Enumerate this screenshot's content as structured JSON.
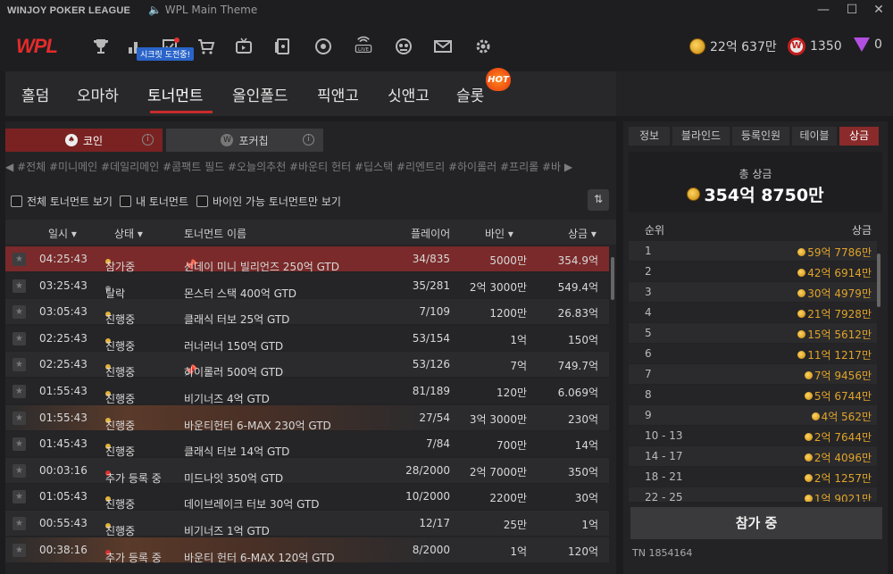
{
  "window": {
    "title": "WINJOY POKER LEAGUE",
    "music": "WPL Main Theme",
    "min": "—",
    "max": "☐",
    "close": "✕"
  },
  "topbar": {
    "logo": "WPL",
    "badge": "시크릿 도전중!",
    "coins": "22억 637만",
    "wpoints": "1350",
    "gems": "0",
    "icons": [
      "trophy-icon",
      "ranking-icon",
      "mission-icon",
      "cart-icon",
      "tv-icon",
      "cards-icon",
      "chip-icon",
      "live-icon",
      "club-icon",
      "mail-icon",
      "settings-icon"
    ]
  },
  "nav": {
    "tabs": [
      "홀덤",
      "오마하",
      "토너먼트",
      "올인폴드",
      "픽앤고",
      "싯앤고",
      "슬롯"
    ],
    "active": 2,
    "hot": "HOT"
  },
  "currency_tabs": [
    {
      "label": "코인",
      "info": "i"
    },
    {
      "label": "포커칩",
      "info": "i"
    }
  ],
  "categories": "◀ #전체 #미니메인 #데일리메인 #콤팩트 필드 #오늘의추천 #바운티 헌터 #딥스택 #리엔트리 #하이롤러 #프리롤 #바 ▶",
  "filters": [
    "전체 토너먼트 보기",
    "내 토너먼트",
    "바이인 가능 토너먼트만 보기"
  ],
  "table": {
    "headers": [
      "일시 ▾",
      "상태 ▾",
      "토너먼트 이름",
      "플레이어",
      "바인 ▾",
      "상금 ▾"
    ],
    "rows": [
      {
        "time": "04:25:43",
        "status": "참가중",
        "dot": "#e2b33a",
        "name": "선데이 미니 빌리언즈 250억 GTD",
        "pin": "📌",
        "players": "34/835",
        "buyin": "5000만",
        "prize": "354.9억"
      },
      {
        "time": "03:25:43",
        "status": "탈락",
        "dot": "#777",
        "name": "몬스터 스택 400억 GTD",
        "pin": "",
        "players": "35/281",
        "buyin": "2억 3000만",
        "prize": "549.4억"
      },
      {
        "time": "03:05:43",
        "status": "진행중",
        "dot": "#e2b33a",
        "name": "클래식 터보 25억 GTD",
        "pin": "",
        "players": "7/109",
        "buyin": "1200만",
        "prize": "26.83억"
      },
      {
        "time": "02:25:43",
        "status": "진행중",
        "dot": "#e2b33a",
        "name": "러너러너 150억 GTD",
        "pin": "",
        "players": "53/154",
        "buyin": "1억",
        "prize": "150억"
      },
      {
        "time": "02:25:43",
        "status": "진행중",
        "dot": "#e2b33a",
        "name": "하이롤러 500억 GTD",
        "pin": "📌",
        "players": "53/126",
        "buyin": "7억",
        "prize": "749.7억"
      },
      {
        "time": "01:55:43",
        "status": "진행중",
        "dot": "#e2b33a",
        "name": "비기너즈 4억 GTD",
        "pin": "",
        "players": "81/189",
        "buyin": "120만",
        "prize": "6.069억"
      },
      {
        "time": "01:55:43",
        "status": "진행중",
        "dot": "#e2b33a",
        "name": "바운티헌터 6-MAX 230억 GTD",
        "pin": "",
        "players": "27/54",
        "buyin": "3억 3000만",
        "prize": "230억"
      },
      {
        "time": "01:45:43",
        "status": "진행중",
        "dot": "#e2b33a",
        "name": "클래식 터보 14억 GTD",
        "pin": "",
        "players": "7/84",
        "buyin": "700만",
        "prize": "14억"
      },
      {
        "time": "00:03:16",
        "status": "추가 등록 중",
        "dot": "#d8322e",
        "name": "미드나잇 350억 GTD",
        "pin": "",
        "players": "28/2000",
        "buyin": "2억 7000만",
        "prize": "350억"
      },
      {
        "time": "01:05:43",
        "status": "진행중",
        "dot": "#e2b33a",
        "name": "데이브레이크 터보 30억 GTD",
        "pin": "",
        "players": "10/2000",
        "buyin": "2200만",
        "prize": "30억"
      },
      {
        "time": "00:55:43",
        "status": "진행중",
        "dot": "#e2b33a",
        "name": "비기너즈 1억 GTD",
        "pin": "",
        "players": "12/17",
        "buyin": "25만",
        "prize": "1억"
      },
      {
        "time": "00:38:16",
        "status": "추가 등록 중",
        "dot": "#d8322e",
        "name": "바운티 헌터 6-MAX 120억 GTD",
        "pin": "",
        "players": "8/2000",
        "buyin": "1억",
        "prize": "120억"
      }
    ]
  },
  "right": {
    "tabs": [
      "정보",
      "블라인드",
      "등록인원",
      "테이블",
      "상금"
    ],
    "active": 4,
    "total_label": "총 상금",
    "total": "354억 8750만",
    "headers": [
      "순위",
      "상금"
    ],
    "ranks": [
      {
        "rank": "1",
        "prize": "59억 7786만"
      },
      {
        "rank": "2",
        "prize": "42억 6914만"
      },
      {
        "rank": "3",
        "prize": "30억 4979만"
      },
      {
        "rank": "4",
        "prize": "21억 7928만"
      },
      {
        "rank": "5",
        "prize": "15억 5612만"
      },
      {
        "rank": "6",
        "prize": "11억 1217만"
      },
      {
        "rank": "7",
        "prize": "7억 9456만"
      },
      {
        "rank": "8",
        "prize": "5억 6744만"
      },
      {
        "rank": "9",
        "prize": "4억 562만"
      },
      {
        "rank": "10 - 13",
        "prize": "2억 7644만"
      },
      {
        "rank": "14 - 17",
        "prize": "2억 4096만"
      },
      {
        "rank": "18 - 21",
        "prize": "2억 1257만"
      },
      {
        "rank": "22 - 25",
        "prize": "1억 9021만"
      }
    ],
    "join": "참가 중",
    "tn": "TN  1854164"
  }
}
